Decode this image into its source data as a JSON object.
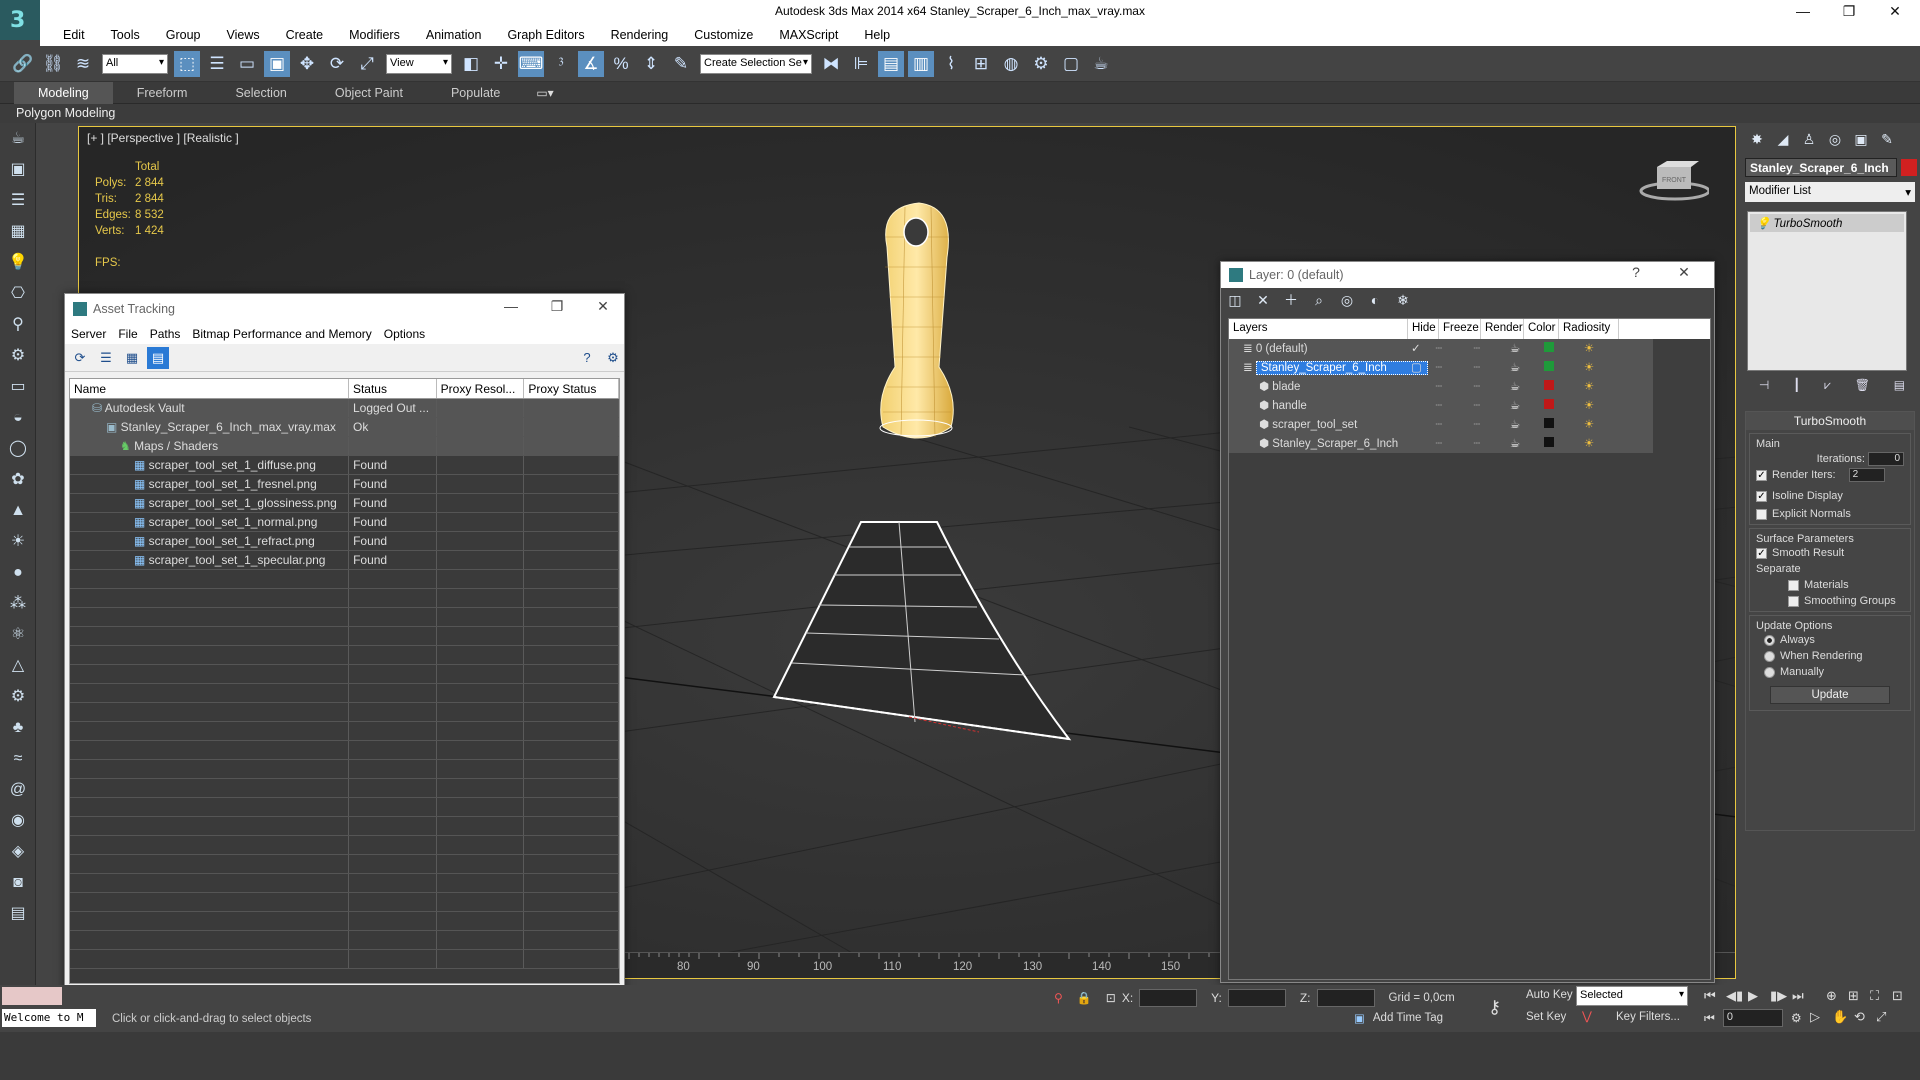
{
  "window": {
    "title": "Autodesk 3ds Max  2014 x64     Stanley_Scraper_6_Inch_max_vray.max",
    "logo": "3",
    "minimize": "—",
    "maximize": "❐",
    "close": "✕"
  },
  "menu": [
    "Edit",
    "Tools",
    "Group",
    "Views",
    "Create",
    "Modifiers",
    "Animation",
    "Graph Editors",
    "Rendering",
    "Customize",
    "MAXScript",
    "Help"
  ],
  "toolbar": {
    "filter": "All",
    "refcoord": "View",
    "selection_set": "Create Selection Se"
  },
  "ribbon": {
    "tabs": [
      "Modeling",
      "Freeform",
      "Selection",
      "Object Paint",
      "Populate"
    ],
    "active": "Modeling",
    "sub": "Polygon Modeling"
  },
  "viewport": {
    "label": "[+ ] [Perspective ] [Realistic ]",
    "stats": {
      "header": "Total",
      "rows": [
        {
          "k": "Polys:",
          "v": "2 844"
        },
        {
          "k": "Tris:",
          "v": "2 844"
        },
        {
          "k": "Edges:",
          "v": "8 532"
        },
        {
          "k": "Verts:",
          "v": "1 424"
        }
      ],
      "fps": "FPS:"
    },
    "gizmo_label": "FRONT"
  },
  "timeline": {
    "ticks": [
      "80",
      "90",
      "100",
      "110",
      "120",
      "130",
      "140",
      "150"
    ]
  },
  "assets": {
    "title": "Asset Tracking",
    "menu": [
      "Server",
      "File",
      "Paths",
      "Bitmap Performance and Memory",
      "Options"
    ],
    "columns": [
      "Name",
      "Status",
      "Proxy Resol...",
      "Proxy Status"
    ],
    "rows": [
      {
        "name": "Autodesk Vault",
        "status": "Logged Out ...",
        "indent": 0
      },
      {
        "name": "Stanley_Scraper_6_Inch_max_vray.max",
        "status": "Ok",
        "indent": 1
      },
      {
        "name": "Maps / Shaders",
        "status": "",
        "indent": 2
      },
      {
        "name": "scraper_tool_set_1_diffuse.png",
        "status": "Found",
        "indent": 3
      },
      {
        "name": "scraper_tool_set_1_fresnel.png",
        "status": "Found",
        "indent": 3
      },
      {
        "name": "scraper_tool_set_1_glossiness.png",
        "status": "Found",
        "indent": 3
      },
      {
        "name": "scraper_tool_set_1_normal.png",
        "status": "Found",
        "indent": 3
      },
      {
        "name": "scraper_tool_set_1_refract.png",
        "status": "Found",
        "indent": 3
      },
      {
        "name": "scraper_tool_set_1_specular.png",
        "status": "Found",
        "indent": 3
      }
    ]
  },
  "layers": {
    "title": "Layer: 0 (default)",
    "help": "?",
    "columns": [
      "Layers",
      "Hide",
      "Freeze",
      "Render",
      "Color",
      "Radiosity"
    ],
    "rows": [
      {
        "name": "0 (default)",
        "color": "#1f9a3a",
        "indent": 0,
        "sel": false
      },
      {
        "name": "Stanley_Scraper_6_Inch",
        "color": "#1f9a3a",
        "indent": 0,
        "sel": true
      },
      {
        "name": "blade",
        "color": "#c01818",
        "indent": 1,
        "sel": false
      },
      {
        "name": "handle",
        "color": "#c01818",
        "indent": 1,
        "sel": false
      },
      {
        "name": "scraper_tool_set",
        "color": "#111111",
        "indent": 1,
        "sel": false
      },
      {
        "name": "Stanley_Scraper_6_Inch",
        "color": "#111111",
        "indent": 1,
        "sel": false
      }
    ]
  },
  "panel": {
    "object_name": "Stanley_Scraper_6_Inch",
    "object_color": "#d02020",
    "modifier_list": "Modifier List",
    "stack_item": "TurboSmooth",
    "rollout": "TurboSmooth",
    "main": "Main",
    "iterations_label": "Iterations:",
    "iterations": "0",
    "render_iters_label": "Render Iters:",
    "render_iters": "2",
    "isoline": "Isoline Display",
    "explicit": "Explicit Normals",
    "surface": "Surface Parameters",
    "smooth": "Smooth Result",
    "separate": "Separate",
    "materials": "Materials",
    "smoothing": "Smoothing Groups",
    "update_opts": "Update Options",
    "always": "Always",
    "when_rendering": "When Rendering",
    "manually": "Manually",
    "update_btn": "Update"
  },
  "status": {
    "welcome": "Welcome to M",
    "prompt": "Click or click-and-drag to select objects",
    "x_label": "X:",
    "y_label": "Y:",
    "z_label": "Z:",
    "grid": "Grid = 0,0cm",
    "add_time_tag": "Add Time Tag",
    "auto_key": "Auto Key",
    "set_key": "Set Key",
    "selected": "Selected",
    "key_filters": "Key Filters...",
    "frame": "0"
  }
}
